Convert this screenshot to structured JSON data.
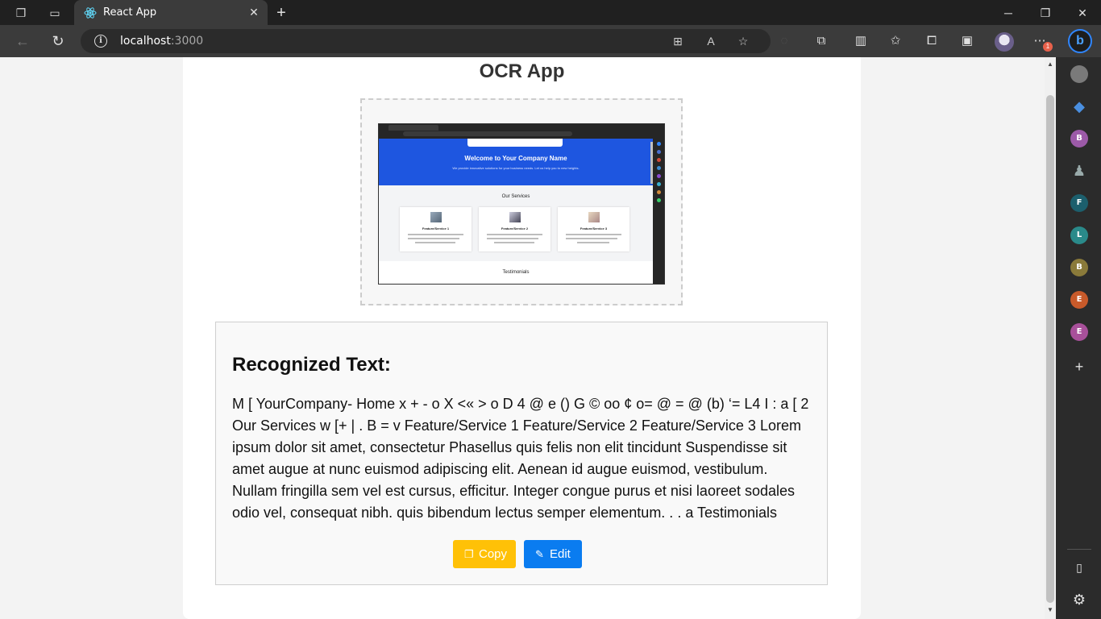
{
  "browser": {
    "tab_title": "React App",
    "url_host": "localhost",
    "url_port": ":3000",
    "menu_badge": "1",
    "sidebar_profiles": [
      "B",
      "F",
      "L",
      "B",
      "E",
      "E"
    ],
    "sidebar_profile_colors": [
      "#9c5aa8",
      "#1c5f6d",
      "#2a8a8a",
      "#8a7a3a",
      "#c85a2a",
      "#a8509a"
    ]
  },
  "app": {
    "title": "OCR App",
    "preview": {
      "hero_title": "Welcome to Your Company Name",
      "hero_subtitle": "We provide innovative solutions for your business needs. Let us help you to new heights.",
      "services_title": "Our Services",
      "cards": [
        {
          "title": "Feature/Service 1"
        },
        {
          "title": "Feature/Service 2"
        },
        {
          "title": "Feature/Service 3"
        }
      ],
      "testimonials_title": "Testimonials"
    },
    "result": {
      "heading": "Recognized Text:",
      "text": "M [ YourCompany- Home x + - o X <« > o D 4 @ e () G © oo ¢ o= @ = @ (b) ‘= L4 I : a [ 2 Our Services w [+ | . B = v Feature/Service 1 Feature/Service 2 Feature/Service 3 Lorem ipsum dolor sit amet, consectetur Phasellus quis felis non elit tincidunt Suspendisse sit amet augue at nunc euismod adipiscing elit. Aenean id augue euismod, vestibulum. Nullam fringilla sem vel est cursus, efficitur. Integer congue purus et nisi laoreet sodales odio vel, consequat nibh. quis bibendum lectus semper elementum. . . a Testimonials",
      "copy_label": "Copy",
      "edit_label": "Edit"
    }
  },
  "colors": {
    "copy_button": "#ffc107",
    "edit_button": "#0a7cf0",
    "hero_blue": "#1e56e0"
  }
}
